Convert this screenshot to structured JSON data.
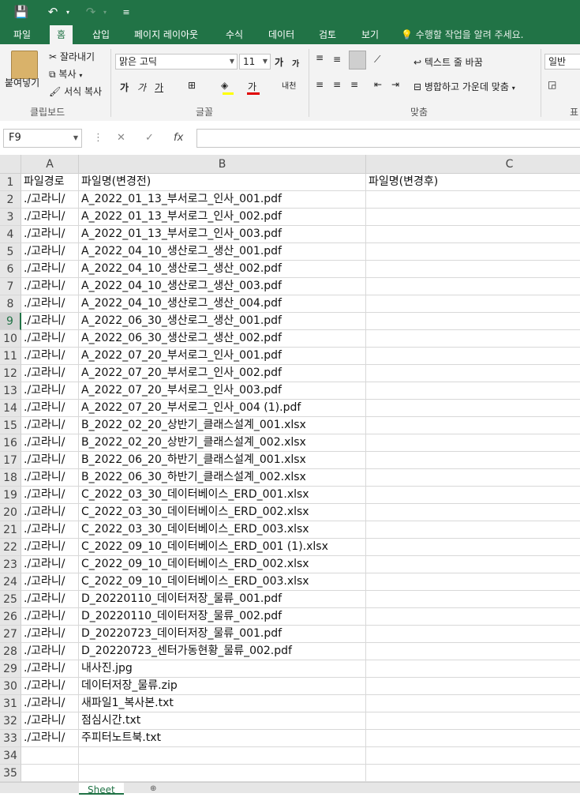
{
  "quick_access": {
    "save_icon": "💾",
    "undo_icon": "↶",
    "redo_icon": "↷",
    "customize_icon": "≡"
  },
  "tabs": [
    "파일",
    "홈",
    "삽입",
    "페이지 레이아웃",
    "수식",
    "데이터",
    "검토",
    "보기"
  ],
  "active_tab": "홈",
  "tell_me": "수행할 작업을 알려 주세요.",
  "ribbon": {
    "clipboard": {
      "paste": "붙여넣기",
      "cut": "잘라내기",
      "copy": "복사",
      "format_painter": "서식 복사",
      "group": "클립보드"
    },
    "font": {
      "name": "맑은 고딕",
      "size": "11",
      "grow": "가",
      "shrink": "가",
      "bold": "가",
      "italic": "가",
      "underline": "가",
      "group": "글꼴"
    },
    "alignment": {
      "wrap": "텍스트 줄 바꿈",
      "merge": "병합하고 가운데 맞춤",
      "group": "맞춤"
    },
    "number": {
      "format": "일반",
      "group": "표"
    }
  },
  "formula_bar": {
    "name_box": "F9",
    "fx": "fx",
    "value": ""
  },
  "columns": [
    "A",
    "B",
    "C"
  ],
  "selected_row": 9,
  "rows": [
    {
      "n": "1",
      "a": "파일경로",
      "b": "파일명(변경전)",
      "c": "파일명(변경후)"
    },
    {
      "n": "2",
      "a": "./고라니/",
      "b": "A_2022_01_13_부서로그_인사_001.pdf",
      "c": ""
    },
    {
      "n": "3",
      "a": "./고라니/",
      "b": "A_2022_01_13_부서로그_인사_002.pdf",
      "c": ""
    },
    {
      "n": "4",
      "a": "./고라니/",
      "b": "A_2022_01_13_부서로그_인사_003.pdf",
      "c": ""
    },
    {
      "n": "5",
      "a": "./고라니/",
      "b": "A_2022_04_10_생산로그_생산_001.pdf",
      "c": ""
    },
    {
      "n": "6",
      "a": "./고라니/",
      "b": "A_2022_04_10_생산로그_생산_002.pdf",
      "c": ""
    },
    {
      "n": "7",
      "a": "./고라니/",
      "b": "A_2022_04_10_생산로그_생산_003.pdf",
      "c": ""
    },
    {
      "n": "8",
      "a": "./고라니/",
      "b": "A_2022_04_10_생산로그_생산_004.pdf",
      "c": ""
    },
    {
      "n": "9",
      "a": "./고라니/",
      "b": "A_2022_06_30_생산로그_생산_001.pdf",
      "c": ""
    },
    {
      "n": "10",
      "a": "./고라니/",
      "b": "A_2022_06_30_생산로그_생산_002.pdf",
      "c": ""
    },
    {
      "n": "11",
      "a": "./고라니/",
      "b": "A_2022_07_20_부서로그_인사_001.pdf",
      "c": ""
    },
    {
      "n": "12",
      "a": "./고라니/",
      "b": "A_2022_07_20_부서로그_인사_002.pdf",
      "c": ""
    },
    {
      "n": "13",
      "a": "./고라니/",
      "b": "A_2022_07_20_부서로그_인사_003.pdf",
      "c": ""
    },
    {
      "n": "14",
      "a": "./고라니/",
      "b": "A_2022_07_20_부서로그_인사_004 (1).pdf",
      "c": ""
    },
    {
      "n": "15",
      "a": "./고라니/",
      "b": "B_2022_02_20_상반기_클래스설계_001.xlsx",
      "c": ""
    },
    {
      "n": "16",
      "a": "./고라니/",
      "b": "B_2022_02_20_상반기_클래스설계_002.xlsx",
      "c": ""
    },
    {
      "n": "17",
      "a": "./고라니/",
      "b": "B_2022_06_20_하반기_클래스설계_001.xlsx",
      "c": ""
    },
    {
      "n": "18",
      "a": "./고라니/",
      "b": "B_2022_06_30_하반기_클래스설계_002.xlsx",
      "c": ""
    },
    {
      "n": "19",
      "a": "./고라니/",
      "b": "C_2022_03_30_데이터베이스_ERD_001.xlsx",
      "c": ""
    },
    {
      "n": "20",
      "a": "./고라니/",
      "b": "C_2022_03_30_데이터베이스_ERD_002.xlsx",
      "c": ""
    },
    {
      "n": "21",
      "a": "./고라니/",
      "b": "C_2022_03_30_데이터베이스_ERD_003.xlsx",
      "c": ""
    },
    {
      "n": "22",
      "a": "./고라니/",
      "b": "C_2022_09_10_데이터베이스_ERD_001 (1).xlsx",
      "c": ""
    },
    {
      "n": "23",
      "a": "./고라니/",
      "b": "C_2022_09_10_데이터베이스_ERD_002.xlsx",
      "c": ""
    },
    {
      "n": "24",
      "a": "./고라니/",
      "b": "C_2022_09_10_데이터베이스_ERD_003.xlsx",
      "c": ""
    },
    {
      "n": "25",
      "a": "./고라니/",
      "b": "D_20220110_데이터저장_물류_001.pdf",
      "c": ""
    },
    {
      "n": "26",
      "a": "./고라니/",
      "b": "D_20220110_데이터저장_물류_002.pdf",
      "c": ""
    },
    {
      "n": "27",
      "a": "./고라니/",
      "b": "D_20220723_데이터저장_물류_001.pdf",
      "c": ""
    },
    {
      "n": "28",
      "a": "./고라니/",
      "b": "D_20220723_센터가동현황_물류_002.pdf",
      "c": ""
    },
    {
      "n": "29",
      "a": "./고라니/",
      "b": "내사진.jpg",
      "c": ""
    },
    {
      "n": "30",
      "a": "./고라니/",
      "b": "데이터저장_물류.zip",
      "c": ""
    },
    {
      "n": "31",
      "a": "./고라니/",
      "b": "새파일1_복사본.txt",
      "c": ""
    },
    {
      "n": "32",
      "a": "./고라니/",
      "b": "점심시간.txt",
      "c": ""
    },
    {
      "n": "33",
      "a": "./고라니/",
      "b": "주피터노트북.txt",
      "c": ""
    },
    {
      "n": "34",
      "a": "",
      "b": "",
      "c": ""
    },
    {
      "n": "35",
      "a": "",
      "b": "",
      "c": ""
    }
  ],
  "sheet_tab": "Sheet"
}
